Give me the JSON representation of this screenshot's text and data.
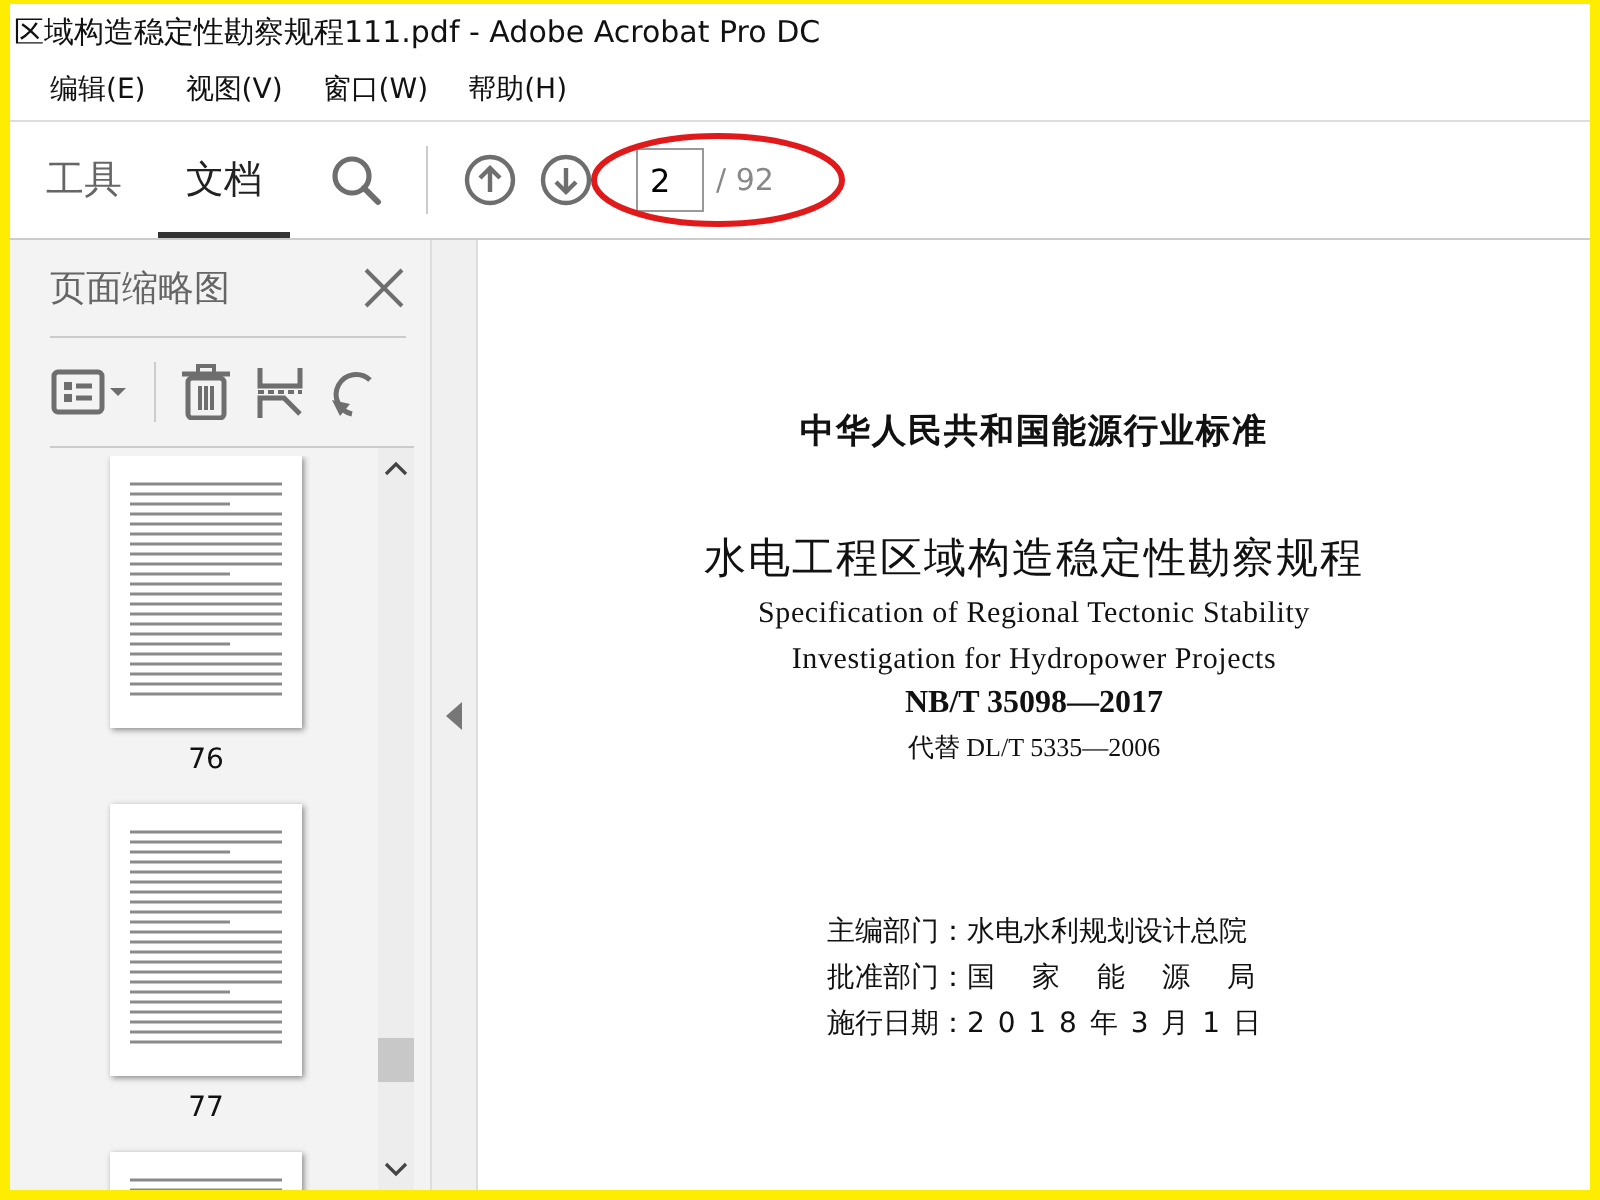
{
  "window": {
    "title": "区域构造稳定性勘察规程111.pdf - Adobe Acrobat Pro DC"
  },
  "menu": [
    "编辑(E)",
    "视图(V)",
    "窗口(W)",
    "帮助(H)"
  ],
  "tabs": [
    {
      "label": "工具",
      "selected": false
    },
    {
      "label": "文档",
      "selected": true
    }
  ],
  "page_nav": {
    "value": "2",
    "total": "/ 92"
  },
  "sidebar": {
    "title": "页面缩略图",
    "thumbnails": [
      {
        "label": "76"
      },
      {
        "label": "77"
      }
    ]
  },
  "document": {
    "header": "中华人民共和国能源行业标准",
    "title": "水电工程区域构造稳定性勘察规程",
    "english": [
      "Specification of Regional Tectonic Stability",
      "Investigation for Hydropower Projects"
    ],
    "code": "NB/T 35098—2017",
    "replaces": "代替 DL/T 5335—2006",
    "details": [
      {
        "label": "主编部门：",
        "value": "水电水利规划设计总院"
      },
      {
        "label": "批准部门：",
        "value": "国 家 能 源 局"
      },
      {
        "label": "施行日期：",
        "value": "2 0 1 8 年 3 月 1 日"
      }
    ]
  }
}
